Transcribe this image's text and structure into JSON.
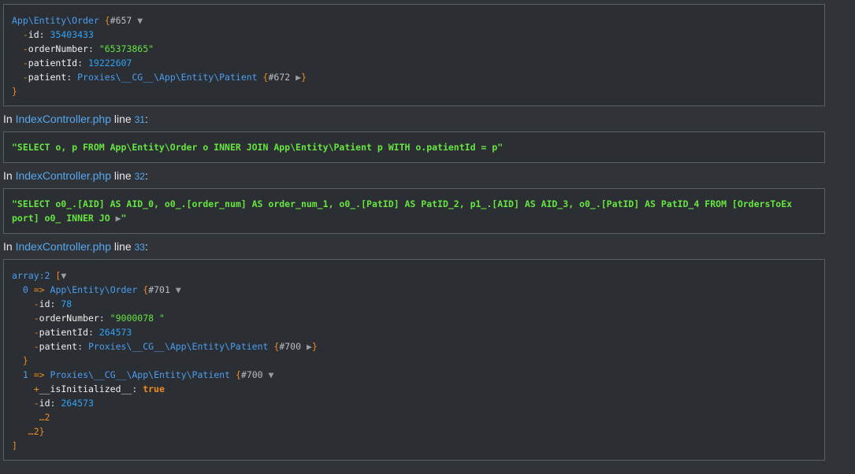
{
  "dump1": {
    "class": "App\\Entity\\Order",
    "ref": "#657",
    "fields": {
      "id_key": "id",
      "id_val": "35403433",
      "orderNumber_key": "orderNumber",
      "orderNumber_val": "\"65373865\"",
      "patientId_key": "patientId",
      "patientId_val": "19222607",
      "patient_key": "patient",
      "patient_class": "Proxies\\__CG__\\App\\Entity\\Patient",
      "patient_ref": "#672"
    }
  },
  "loc1": {
    "prefix": "In",
    "file": "IndexController.php",
    "line_word": "line",
    "line": "31",
    "colon": ":"
  },
  "dump2": {
    "sql": "\"SELECT o, p FROM App\\Entity\\Order o INNER JOIN App\\Entity\\Patient p WITH o.patientId = p\""
  },
  "loc2": {
    "prefix": "In",
    "file": "IndexController.php",
    "line_word": "line",
    "line": "32",
    "colon": ":"
  },
  "dump3": {
    "sql_line1": "\"SELECT o0_.[AID] AS AID_0, o0_.[order_num] AS order_num_1, o0_.[PatID] AS PatID_2, p1_.[AID] AS AID_3, o0_.[PatID] AS PatID_4 FROM [OrdersToEx",
    "sql_line2": "port] o0_ INNER JO",
    "sql_end": "\""
  },
  "loc3": {
    "prefix": "In",
    "file": "IndexController.php",
    "line_word": "line",
    "line": "33",
    "colon": ":"
  },
  "dump4": {
    "array_label": "array:2",
    "item0": {
      "index": "0",
      "class": "App\\Entity\\Order",
      "ref": "#701",
      "id_key": "id",
      "id_val": "78",
      "orderNumber_key": "orderNumber",
      "orderNumber_val": "\"9000078 \"",
      "patientId_key": "patientId",
      "patientId_val": "264573",
      "patient_key": "patient",
      "patient_class": "Proxies\\__CG__\\App\\Entity\\Patient",
      "patient_ref": "#700"
    },
    "item1": {
      "index": "1",
      "class": "Proxies\\__CG__\\App\\Entity\\Patient",
      "ref": "#700",
      "init_key": "__isInitialized__",
      "init_val": "true",
      "id_key": "id",
      "id_val": "264573",
      "more": "…2",
      "close_more": "…2"
    }
  },
  "colors": {
    "background": "#303338",
    "panel": "#2b2e33",
    "class": "#4b9ef0",
    "brace": "#ee8b1e",
    "string": "#67e540",
    "number": "#2fa4f5"
  },
  "icons": {
    "collapse": "triangle-down",
    "expand": "triangle-right"
  }
}
